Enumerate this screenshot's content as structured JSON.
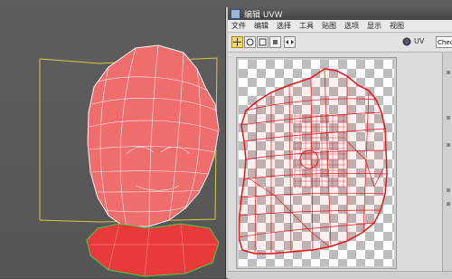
{
  "window": {
    "title": "编辑 UVW",
    "menu": [
      "文件",
      "编辑",
      "选择",
      "工具",
      "贴图",
      "选项",
      "显示",
      "视图"
    ]
  },
  "toolbar": {
    "uv_label": "UV",
    "checker_dropdown": "Checker"
  },
  "icons": {
    "move": "move-icon",
    "rotate": "rotate-icon",
    "scale": "scale-icon",
    "freeform": "freeform-icon",
    "mirror": "mirror-icon",
    "camera": "camera-icon"
  },
  "colors": {
    "wire": "#e8141d",
    "mesh": "#ef7474",
    "bbox": "#d8c84a",
    "selection": "#43d043"
  }
}
